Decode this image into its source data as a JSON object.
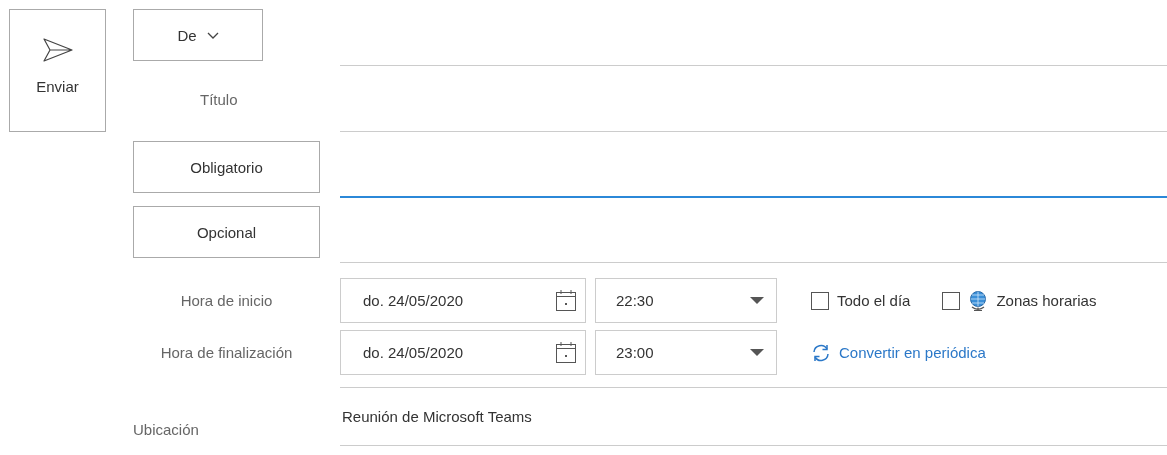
{
  "send_button": {
    "label": "Enviar"
  },
  "from_button": {
    "label": "De"
  },
  "title_field": {
    "label": "Título"
  },
  "required": {
    "label": "Obligatorio",
    "focused": true
  },
  "optional": {
    "label": "Opcional",
    "focused": false
  },
  "times": [
    {
      "label": "Hora de inicio",
      "date": "do. 24/05/2020",
      "time": "22:30"
    },
    {
      "label": "Hora de finalización",
      "date": "do. 24/05/2020",
      "time": "23:00"
    }
  ],
  "options": [
    {
      "kind": "checkbox",
      "label": "Todo el día",
      "checked": false
    },
    {
      "kind": "timezone",
      "label": "Zonas horarias",
      "checked": false
    }
  ],
  "recurrence_link": {
    "label": "Convertir en periódica"
  },
  "location": {
    "label": "Ubicación",
    "value": "Reunión de Microsoft Teams"
  }
}
